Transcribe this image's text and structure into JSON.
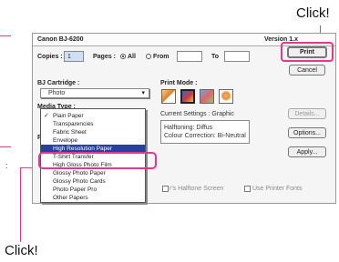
{
  "callouts": {
    "top_label": "Click!",
    "bottom_label": "Click!"
  },
  "dialog": {
    "title": "Canon BJ-6200",
    "version": "Version 1.x",
    "copies_label": "Copies :",
    "copies_value": "1",
    "pages_label": "Pages :",
    "pages_all": "All",
    "pages_from": "From",
    "pages_to": "To",
    "from_value": "",
    "to_value": "",
    "cartridge_label": "BJ Cartridge :",
    "cartridge_value": "Photo",
    "media_type_label": "Media Type :",
    "print_mode_label": "Print Mode :",
    "current_settings_label": "Current Settings : Graphic",
    "settings_line1": "Halftoning: Diffus",
    "settings_line2": "Colour Correction: Bi-Neutral",
    "bottom_option_center": "r's Halftone Screen",
    "bottom_option_right": "Use Printer Fonts",
    "buttons": {
      "print": "Print",
      "cancel": "Cancel",
      "details": "Details...",
      "options": "Options...",
      "apply": "Apply..."
    },
    "media_options": [
      {
        "label": "Plain Paper",
        "checked": true,
        "selected": false
      },
      {
        "label": "Transparencies",
        "checked": false,
        "selected": false
      },
      {
        "label": "Fabric Sheet",
        "checked": false,
        "selected": false
      },
      {
        "label": "Envelope",
        "checked": false,
        "selected": false
      },
      {
        "label": "High Resolution Paper",
        "checked": false,
        "selected": true
      },
      {
        "label": "T-Shirt Transfer",
        "checked": false,
        "selected": false
      },
      {
        "label": "High Gloss Photo Film",
        "checked": false,
        "selected": false
      },
      {
        "label": "Glossy Photo Paper",
        "checked": false,
        "selected": false
      },
      {
        "label": "Glossy Photo Cards",
        "checked": false,
        "selected": false
      },
      {
        "label": "Photo Paper Pro",
        "checked": false,
        "selected": false
      },
      {
        "label": "Other Papers",
        "checked": false,
        "selected": false
      }
    ],
    "colors": {
      "highlight": "#2a3f9e",
      "callout": "#e03a8c"
    }
  }
}
